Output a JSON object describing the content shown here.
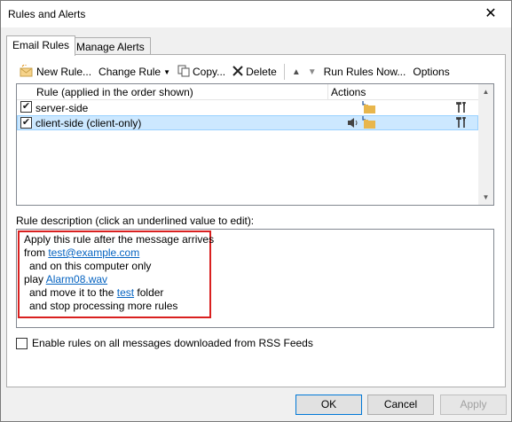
{
  "window": {
    "title": "Rules and Alerts",
    "close_glyph": "✕"
  },
  "tabs": [
    {
      "label": "Email Rules"
    },
    {
      "label": "Manage Alerts"
    }
  ],
  "toolbar": {
    "new_rule": "New Rule...",
    "change_rule": "Change Rule",
    "copy": "Copy...",
    "delete": "Delete",
    "run_rules_now": "Run Rules Now...",
    "options": "Options"
  },
  "rules_list": {
    "col_rule": "Rule (applied in the order shown)",
    "col_actions": "Actions",
    "rows": [
      {
        "name": "server-side",
        "checked": true,
        "selected": false
      },
      {
        "name": "client-side  (client-only)",
        "checked": true,
        "selected": true
      }
    ]
  },
  "description": {
    "label": "Rule description (click an underlined value to edit):",
    "line1": "Apply this rule after the message arrives",
    "line2_prefix": "from ",
    "line2_link": "test@example.com",
    "line3": "and on this computer only",
    "line4_prefix": "play ",
    "line4_link": "Alarm08.wav",
    "line5_prefix": "and move it to the ",
    "line5_link": "test",
    "line5_suffix": " folder",
    "line6": "and stop processing more rules"
  },
  "rss_option": {
    "label": "Enable rules on all messages downloaded from RSS Feeds",
    "checked": false
  },
  "buttons": {
    "ok": "OK",
    "cancel": "Cancel",
    "apply": "Apply"
  },
  "colors": {
    "selection": "#cce8ff",
    "link": "#0563c1",
    "highlight_border": "#d9201f"
  }
}
